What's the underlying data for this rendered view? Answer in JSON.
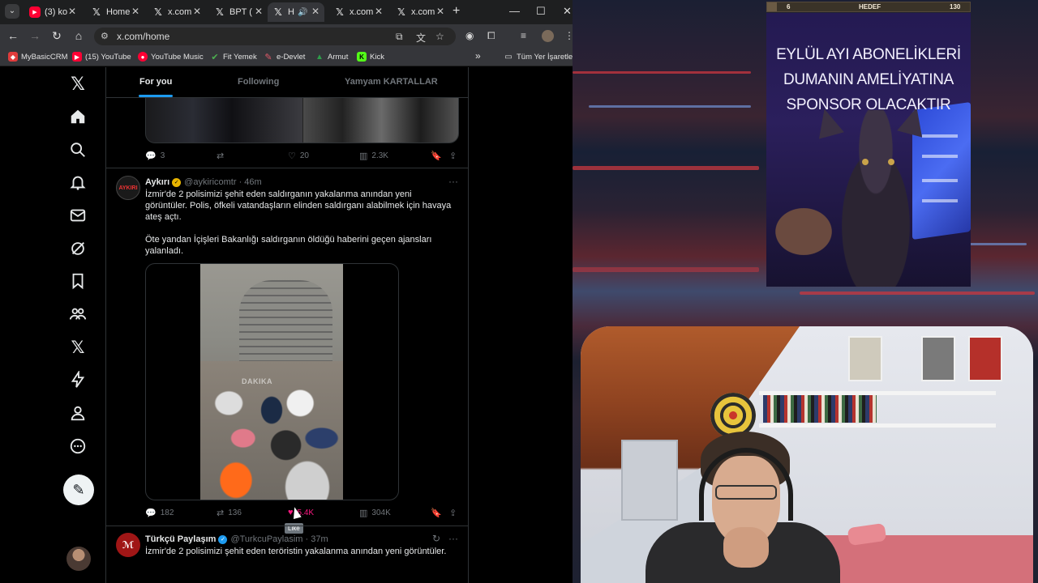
{
  "browser": {
    "tabs": [
      {
        "icon": "youtube-icon",
        "label": "(3) ko",
        "active": false
      },
      {
        "icon": "x-logo-icon",
        "label": "Home",
        "active": false
      },
      {
        "icon": "x-logo-icon",
        "label": "x.com",
        "active": false
      },
      {
        "icon": "x-logo-icon",
        "label": "BPT (",
        "active": false
      },
      {
        "icon": "x-logo-icon",
        "label": "H",
        "active": true
      },
      {
        "icon": "x-logo-icon",
        "label": "x.com",
        "active": false
      },
      {
        "icon": "x-logo-icon",
        "label": "x.com",
        "active": false
      }
    ],
    "url": "x.com/home",
    "bookmarks": [
      {
        "label": "MyBasicCRM",
        "icon": "crm-icon",
        "color": "#e03c3c"
      },
      {
        "label": "(15) YouTube",
        "icon": "youtube-icon",
        "color": "#ff0033"
      },
      {
        "label": "YouTube Music",
        "icon": "youtube-music-icon",
        "color": "#ff0033"
      },
      {
        "label": "Fit Yemek",
        "icon": "fork-icon",
        "color": "#4caf50"
      },
      {
        "label": "e-Devlet",
        "icon": "edevlet-icon",
        "color": "#e05a6a"
      },
      {
        "label": "Armut",
        "icon": "armut-icon",
        "color": "#2e9d4a"
      },
      {
        "label": "Kick",
        "icon": "kick-icon",
        "color": "#53fc18"
      }
    ],
    "bookmarks_more": "»",
    "all_bookmarks": "Tüm Yer İşaretleri"
  },
  "x": {
    "tabs": [
      "For you",
      "Following",
      "Yamyam KARTALLAR"
    ],
    "accent": "#1d9bf0",
    "prev_tweet_stats": {
      "replies": "3",
      "retweets": "",
      "likes": "20",
      "views": "2.3K"
    },
    "tweet1": {
      "avatar_text": "AYKIRI",
      "name": "Aykırı",
      "handle": "@aykiricomtr · 46m",
      "text1": "İzmir'de 2 polisimizi şehit eden saldırganın yakalanma anından yeni görüntüler. Polis, öfkeli vatandaşların elinden saldırganı alabilmek için havaya ateş açtı.",
      "text2": "Öte yandan İçişleri Bakanlığı saldırganın öldüğü haberini geçen ajansları yalanladı.",
      "video_watermark": "DAKIKA",
      "stats": {
        "replies": "182",
        "retweets": "136",
        "likes": "5.4K",
        "views": "304K"
      },
      "like_tooltip": "Like"
    },
    "tweet2": {
      "name": "Türkçü Paylaşım",
      "handle": "@TurkcuPaylasim · 37m",
      "text": "İzmir'de 2 polisimizi şehit eden teröristin yakalanma anından yeni görüntüler."
    }
  },
  "stream": {
    "goal": {
      "current": "6",
      "label": "HEDEF",
      "target": "130",
      "progress": 0.046
    },
    "sponsor_lines": [
      "EYLÜL AYI ABONELİKLERİ",
      "DUMANIN AMELİYATINA",
      "SPONSOR OLACAKTIR"
    ]
  }
}
